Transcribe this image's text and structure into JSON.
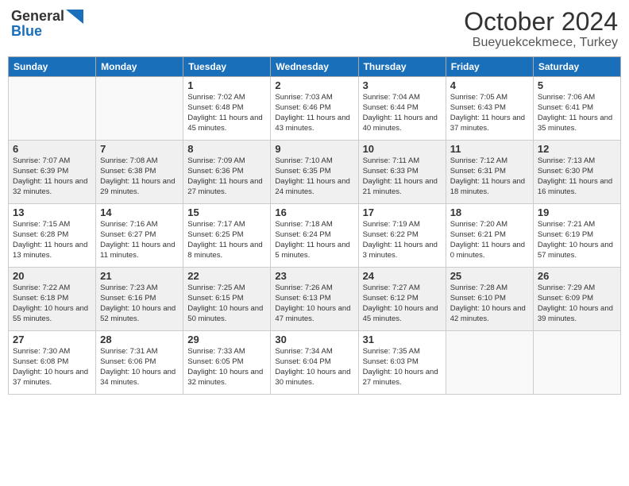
{
  "header": {
    "logo_general": "General",
    "logo_blue": "Blue",
    "month_title": "October 2024",
    "location": "Bueyuekcekmece, Turkey"
  },
  "weekdays": [
    "Sunday",
    "Monday",
    "Tuesday",
    "Wednesday",
    "Thursday",
    "Friday",
    "Saturday"
  ],
  "weeks": [
    {
      "shaded": false,
      "days": [
        {
          "num": "",
          "info": ""
        },
        {
          "num": "",
          "info": ""
        },
        {
          "num": "1",
          "info": "Sunrise: 7:02 AM\nSunset: 6:48 PM\nDaylight: 11 hours and 45 minutes."
        },
        {
          "num": "2",
          "info": "Sunrise: 7:03 AM\nSunset: 6:46 PM\nDaylight: 11 hours and 43 minutes."
        },
        {
          "num": "3",
          "info": "Sunrise: 7:04 AM\nSunset: 6:44 PM\nDaylight: 11 hours and 40 minutes."
        },
        {
          "num": "4",
          "info": "Sunrise: 7:05 AM\nSunset: 6:43 PM\nDaylight: 11 hours and 37 minutes."
        },
        {
          "num": "5",
          "info": "Sunrise: 7:06 AM\nSunset: 6:41 PM\nDaylight: 11 hours and 35 minutes."
        }
      ]
    },
    {
      "shaded": true,
      "days": [
        {
          "num": "6",
          "info": "Sunrise: 7:07 AM\nSunset: 6:39 PM\nDaylight: 11 hours and 32 minutes."
        },
        {
          "num": "7",
          "info": "Sunrise: 7:08 AM\nSunset: 6:38 PM\nDaylight: 11 hours and 29 minutes."
        },
        {
          "num": "8",
          "info": "Sunrise: 7:09 AM\nSunset: 6:36 PM\nDaylight: 11 hours and 27 minutes."
        },
        {
          "num": "9",
          "info": "Sunrise: 7:10 AM\nSunset: 6:35 PM\nDaylight: 11 hours and 24 minutes."
        },
        {
          "num": "10",
          "info": "Sunrise: 7:11 AM\nSunset: 6:33 PM\nDaylight: 11 hours and 21 minutes."
        },
        {
          "num": "11",
          "info": "Sunrise: 7:12 AM\nSunset: 6:31 PM\nDaylight: 11 hours and 18 minutes."
        },
        {
          "num": "12",
          "info": "Sunrise: 7:13 AM\nSunset: 6:30 PM\nDaylight: 11 hours and 16 minutes."
        }
      ]
    },
    {
      "shaded": false,
      "days": [
        {
          "num": "13",
          "info": "Sunrise: 7:15 AM\nSunset: 6:28 PM\nDaylight: 11 hours and 13 minutes."
        },
        {
          "num": "14",
          "info": "Sunrise: 7:16 AM\nSunset: 6:27 PM\nDaylight: 11 hours and 11 minutes."
        },
        {
          "num": "15",
          "info": "Sunrise: 7:17 AM\nSunset: 6:25 PM\nDaylight: 11 hours and 8 minutes."
        },
        {
          "num": "16",
          "info": "Sunrise: 7:18 AM\nSunset: 6:24 PM\nDaylight: 11 hours and 5 minutes."
        },
        {
          "num": "17",
          "info": "Sunrise: 7:19 AM\nSunset: 6:22 PM\nDaylight: 11 hours and 3 minutes."
        },
        {
          "num": "18",
          "info": "Sunrise: 7:20 AM\nSunset: 6:21 PM\nDaylight: 11 hours and 0 minutes."
        },
        {
          "num": "19",
          "info": "Sunrise: 7:21 AM\nSunset: 6:19 PM\nDaylight: 10 hours and 57 minutes."
        }
      ]
    },
    {
      "shaded": true,
      "days": [
        {
          "num": "20",
          "info": "Sunrise: 7:22 AM\nSunset: 6:18 PM\nDaylight: 10 hours and 55 minutes."
        },
        {
          "num": "21",
          "info": "Sunrise: 7:23 AM\nSunset: 6:16 PM\nDaylight: 10 hours and 52 minutes."
        },
        {
          "num": "22",
          "info": "Sunrise: 7:25 AM\nSunset: 6:15 PM\nDaylight: 10 hours and 50 minutes."
        },
        {
          "num": "23",
          "info": "Sunrise: 7:26 AM\nSunset: 6:13 PM\nDaylight: 10 hours and 47 minutes."
        },
        {
          "num": "24",
          "info": "Sunrise: 7:27 AM\nSunset: 6:12 PM\nDaylight: 10 hours and 45 minutes."
        },
        {
          "num": "25",
          "info": "Sunrise: 7:28 AM\nSunset: 6:10 PM\nDaylight: 10 hours and 42 minutes."
        },
        {
          "num": "26",
          "info": "Sunrise: 7:29 AM\nSunset: 6:09 PM\nDaylight: 10 hours and 39 minutes."
        }
      ]
    },
    {
      "shaded": false,
      "days": [
        {
          "num": "27",
          "info": "Sunrise: 7:30 AM\nSunset: 6:08 PM\nDaylight: 10 hours and 37 minutes."
        },
        {
          "num": "28",
          "info": "Sunrise: 7:31 AM\nSunset: 6:06 PM\nDaylight: 10 hours and 34 minutes."
        },
        {
          "num": "29",
          "info": "Sunrise: 7:33 AM\nSunset: 6:05 PM\nDaylight: 10 hours and 32 minutes."
        },
        {
          "num": "30",
          "info": "Sunrise: 7:34 AM\nSunset: 6:04 PM\nDaylight: 10 hours and 30 minutes."
        },
        {
          "num": "31",
          "info": "Sunrise: 7:35 AM\nSunset: 6:03 PM\nDaylight: 10 hours and 27 minutes."
        },
        {
          "num": "",
          "info": ""
        },
        {
          "num": "",
          "info": ""
        }
      ]
    }
  ]
}
